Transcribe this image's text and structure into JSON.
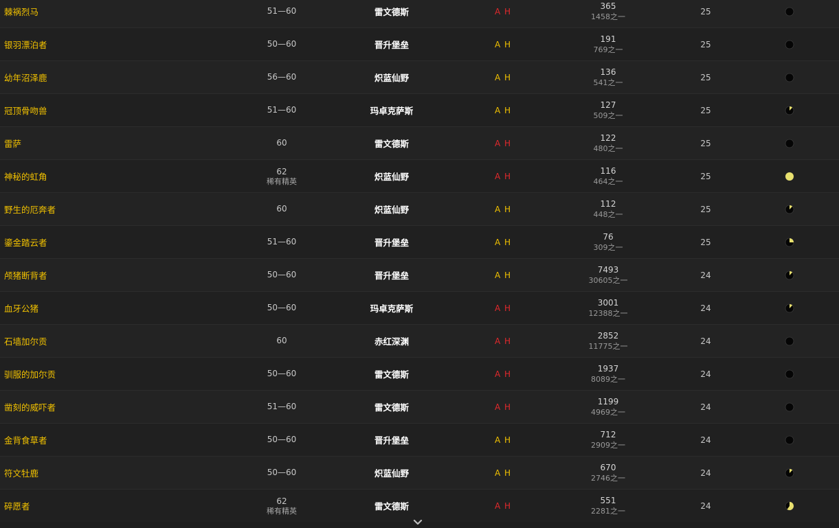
{
  "faction": {
    "a": "A",
    "h": "H"
  },
  "colors": {
    "name": "#f0c000",
    "faction_gold": "#f0c000",
    "faction_red": "#e2292c",
    "pie_fill": "#e8e06e"
  },
  "rows": [
    {
      "name": "棘祸烈马",
      "level": "51—60",
      "level_sub": "",
      "zone": "雷文德斯",
      "faction_color": "red",
      "count": "365",
      "frac": "1458之一",
      "rank": "25",
      "pie": 0.0
    },
    {
      "name": "银羽漂泊者",
      "level": "50—60",
      "level_sub": "",
      "zone": "晋升堡垒",
      "faction_color": "gold",
      "count": "191",
      "frac": "769之一",
      "rank": "25",
      "pie": 0.0
    },
    {
      "name": "幼年沼泽鹿",
      "level": "56—60",
      "level_sub": "",
      "zone": "炽蓝仙野",
      "faction_color": "gold",
      "count": "136",
      "frac": "541之一",
      "rank": "25",
      "pie": 0.0
    },
    {
      "name": "冠顶骨吻兽",
      "level": "51—60",
      "level_sub": "",
      "zone": "玛卓克萨斯",
      "faction_color": "gold",
      "count": "127",
      "frac": "509之一",
      "rank": "25",
      "pie": 0.12
    },
    {
      "name": "雷萨",
      "level": "60",
      "level_sub": "",
      "zone": "雷文德斯",
      "faction_color": "red",
      "count": "122",
      "frac": "480之一",
      "rank": "25",
      "pie": 0.0
    },
    {
      "name": "神秘的虹角",
      "level": "62",
      "level_sub": "稀有精英",
      "zone": "炽蓝仙野",
      "faction_color": "red",
      "count": "116",
      "frac": "464之一",
      "rank": "25",
      "pie": 1.0
    },
    {
      "name": "野生的厄奔者",
      "level": "60",
      "level_sub": "",
      "zone": "炽蓝仙野",
      "faction_color": "gold",
      "count": "112",
      "frac": "448之一",
      "rank": "25",
      "pie": 0.12
    },
    {
      "name": "鎏金踏云者",
      "level": "51—60",
      "level_sub": "",
      "zone": "晋升堡垒",
      "faction_color": "gold",
      "count": "76",
      "frac": "309之一",
      "rank": "25",
      "pie": 0.25
    },
    {
      "name": "颅猪断背者",
      "level": "50—60",
      "level_sub": "",
      "zone": "晋升堡垒",
      "faction_color": "gold",
      "count": "7493",
      "frac": "30605之一",
      "rank": "24",
      "pie": 0.12
    },
    {
      "name": "血牙公猪",
      "level": "50—60",
      "level_sub": "",
      "zone": "玛卓克萨斯",
      "faction_color": "red",
      "count": "3001",
      "frac": "12388之一",
      "rank": "24",
      "pie": 0.12
    },
    {
      "name": "石墙加尔贡",
      "level": "60",
      "level_sub": "",
      "zone": "赤红深渊",
      "faction_color": "red",
      "count": "2852",
      "frac": "11775之一",
      "rank": "24",
      "pie": 0.0
    },
    {
      "name": "驯服的加尔贡",
      "level": "50—60",
      "level_sub": "",
      "zone": "雷文德斯",
      "faction_color": "red",
      "count": "1937",
      "frac": "8089之一",
      "rank": "24",
      "pie": 0.0
    },
    {
      "name": "凿刻的威吓者",
      "level": "51—60",
      "level_sub": "",
      "zone": "雷文德斯",
      "faction_color": "red",
      "count": "1199",
      "frac": "4969之一",
      "rank": "24",
      "pie": 0.0
    },
    {
      "name": "金背食草者",
      "level": "50—60",
      "level_sub": "",
      "zone": "晋升堡垒",
      "faction_color": "gold",
      "count": "712",
      "frac": "2909之一",
      "rank": "24",
      "pie": 0.0
    },
    {
      "name": "符文牡鹿",
      "level": "50—60",
      "level_sub": "",
      "zone": "炽蓝仙野",
      "faction_color": "gold",
      "count": "670",
      "frac": "2746之一",
      "rank": "24",
      "pie": 0.12
    },
    {
      "name": "碎愿者",
      "level": "62",
      "level_sub": "稀有精英",
      "zone": "雷文德斯",
      "faction_color": "red",
      "count": "551",
      "frac": "2281之一",
      "rank": "24",
      "pie": 0.6
    }
  ]
}
